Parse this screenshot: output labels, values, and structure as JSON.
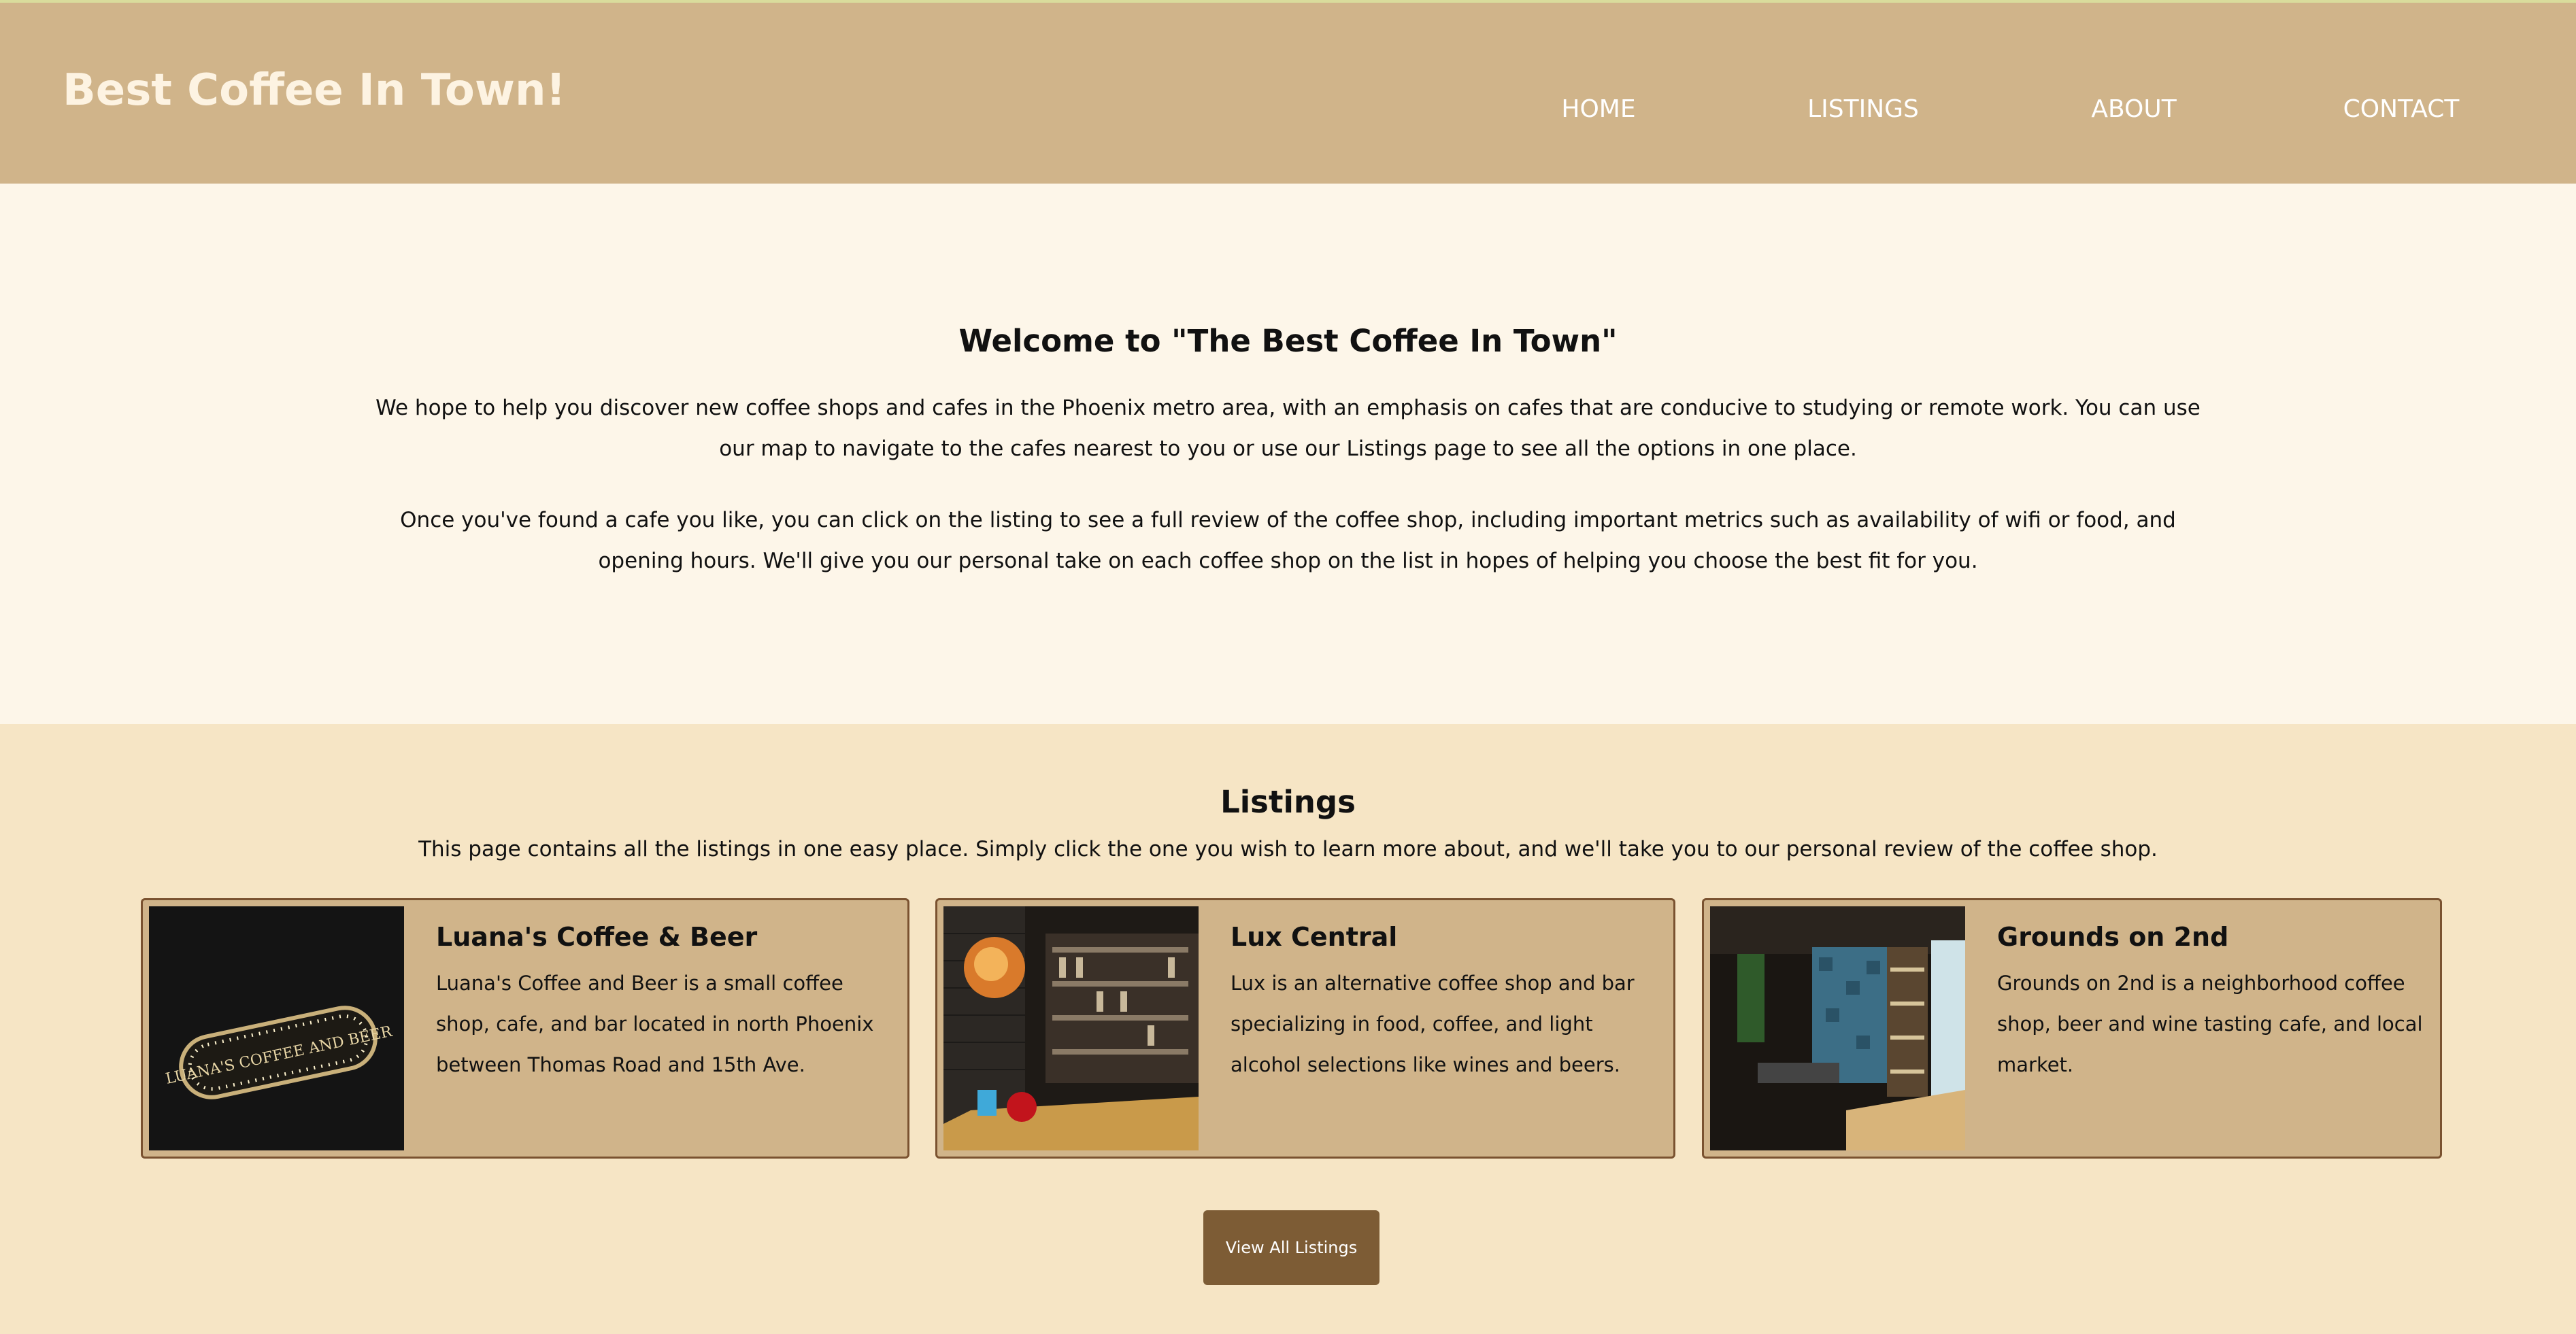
{
  "header": {
    "site_title": "Best Coffee In Town!",
    "nav": [
      {
        "label": "HOME"
      },
      {
        "label": "LISTINGS"
      },
      {
        "label": "ABOUT"
      },
      {
        "label": "CONTACT"
      }
    ]
  },
  "welcome": {
    "title": "Welcome to \"The Best Coffee In Town\"",
    "paragraph_1": "We hope to help you discover new coffee shops and cafes in the Phoenix metro area, with an emphasis on cafes that are conducive to studying or remote work. You can use our map to navigate to the cafes nearest to you or use our Listings page to see all the options in one place.",
    "paragraph_2": "Once you've found a cafe you like, you can click on the listing to see a full review of the coffee shop, including important metrics such as availability of wifi or food, and opening hours. We'll give you our personal take on each coffee shop on the list in hopes of helping you choose the best fit for you."
  },
  "listings": {
    "title": "Listings",
    "description": "This page contains all the listings in one easy place. Simply click the one you wish to learn more about, and we'll take you to our personal review of the coffee shop.",
    "cards": [
      {
        "name": "Luana's Coffee & Beer",
        "description": "Luana's Coffee and Beer is a small coffee shop, cafe, and bar located in north Phoenix between Thomas Road and 15th Ave.",
        "sign_text": "LUANA'S COFFEE AND BEER"
      },
      {
        "name": "Lux Central",
        "description": "Lux is an alternative coffee shop and bar specializing in food, coffee, and light alcohol selections like wines and beers."
      },
      {
        "name": "Grounds on 2nd",
        "description": "Grounds on 2nd is a neighborhood coffee shop, beer and wine tasting cafe, and local market."
      }
    ],
    "view_all_label": "View All Listings"
  },
  "colors": {
    "header_bg": "#d0b48a",
    "welcome_bg": "#fdf6e9",
    "listings_bg": "#f6e5c5",
    "card_border": "#7a5230",
    "button_bg": "#7d5c35"
  }
}
